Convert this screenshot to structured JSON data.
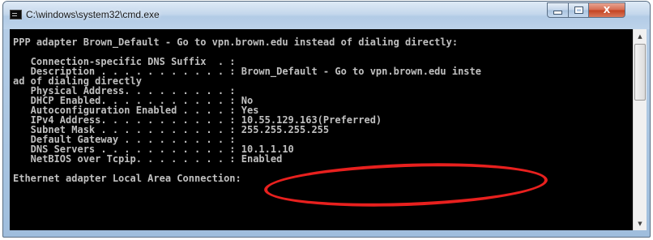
{
  "window": {
    "title": "C:\\windows\\system32\\cmd.exe",
    "icon": "cmd-icon",
    "controls": {
      "minimize": "minimize-icon",
      "maximize": "maximize-icon",
      "close_label": "X"
    }
  },
  "console": {
    "lines": [
      "PPP adapter Brown_Default - Go to vpn.brown.edu instead of dialing directly:",
      "",
      "   Connection-specific DNS Suffix  . :",
      "   Description . . . . . . . . . . . : Brown_Default - Go to vpn.brown.edu inste",
      "ad of dialing directly",
      "   Physical Address. . . . . . . . . :",
      "   DHCP Enabled. . . . . . . . . . . : No",
      "   Autoconfiguration Enabled . . . . : Yes",
      "   IPv4 Address. . . . . . . . . . . : 10.55.129.163(Preferred)",
      "   Subnet Mask . . . . . . . . . . . : 255.255.255.255",
      "   Default Gateway . . . . . . . . . :",
      "   DNS Servers . . . . . . . . . . . : 10.1.1.10",
      "   NetBIOS over Tcpip. . . . . . . . : Enabled",
      "",
      "Ethernet adapter Local Area Connection:"
    ]
  },
  "annotation": {
    "color": "#e8201e",
    "target": "IPv4 Address"
  },
  "colors": {
    "console_bg": "#000000",
    "console_fg": "#c0c0c0",
    "close_button": "#c3411f"
  }
}
